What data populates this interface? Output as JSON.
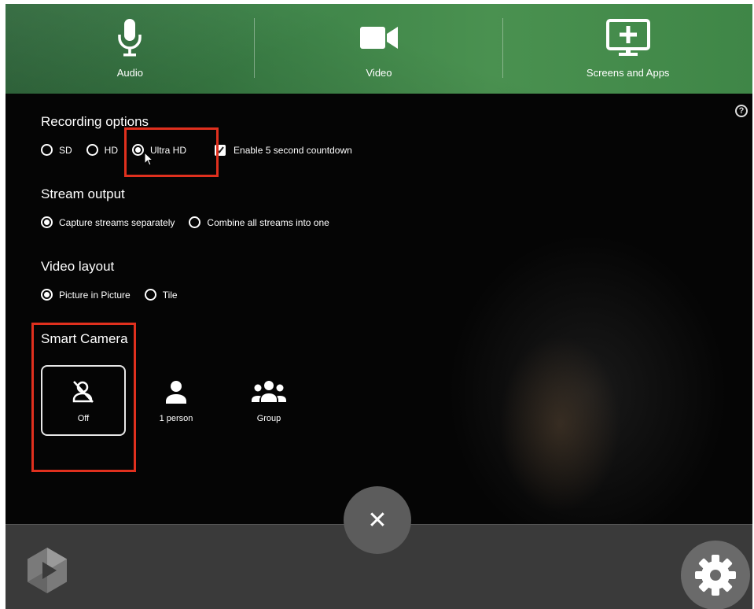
{
  "tabs": [
    {
      "label": "Audio",
      "icon": "microphone-icon"
    },
    {
      "label": "Video",
      "icon": "video-camera-icon"
    },
    {
      "label": "Screens and Apps",
      "icon": "screen-add-icon"
    }
  ],
  "recording": {
    "title": "Recording options",
    "options": [
      "SD",
      "HD",
      "Ultra HD"
    ],
    "selected": "Ultra HD",
    "countdown_label": "Enable 5 second countdown",
    "countdown_checked": true
  },
  "stream": {
    "title": "Stream output",
    "options": [
      "Capture streams separately",
      "Combine all streams into one"
    ],
    "selected": "Capture streams separately"
  },
  "layout": {
    "title": "Video layout",
    "options": [
      "Picture in Picture",
      "Tile"
    ],
    "selected": "Picture in Picture"
  },
  "smart_camera": {
    "title": "Smart Camera",
    "options": [
      {
        "label": "Off",
        "icon": "person-off-icon"
      },
      {
        "label": "1 person",
        "icon": "person-icon"
      },
      {
        "label": "Group",
        "icon": "group-icon"
      }
    ],
    "selected": "Off"
  },
  "help_glyph": "?",
  "close_glyph": "✕",
  "colors": {
    "accent_green": "#3d8348",
    "highlight_red": "#e0301e"
  }
}
